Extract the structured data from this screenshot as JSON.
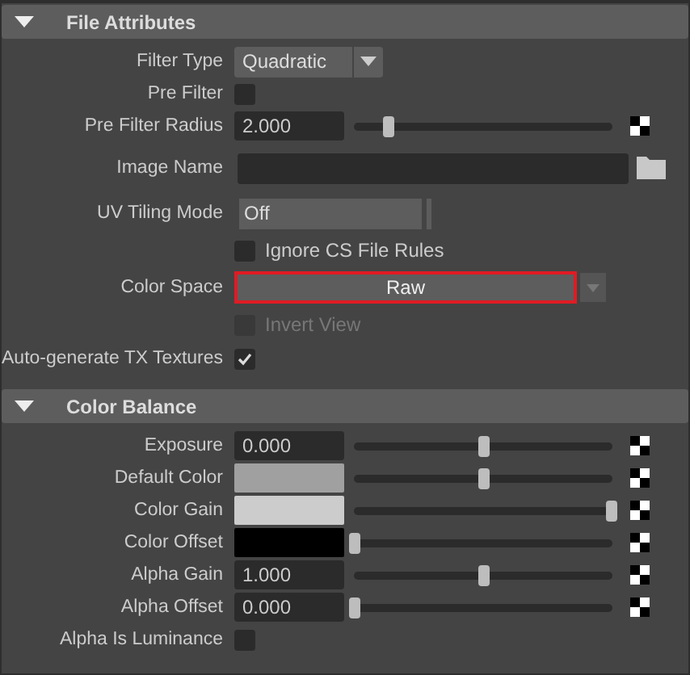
{
  "sections": [
    {
      "title": "File Attributes",
      "expanded": true,
      "rows": [
        {
          "kind": "dropdown",
          "label": "Filter Type",
          "value": "Quadratic"
        },
        {
          "kind": "checkbox",
          "label": "Pre Filter",
          "checked": false
        },
        {
          "kind": "slider",
          "label": "Pre Filter Radius",
          "value": "2.000",
          "level": 0.13
        },
        {
          "kind": "file",
          "label": "Image Name"
        },
        {
          "kind": "option",
          "label": "UV Tiling Mode",
          "value": "Off"
        },
        {
          "kind": "inline-checkbox",
          "text": "Ignore CS File Rules",
          "checked": false,
          "disabled": false
        },
        {
          "kind": "colorspace",
          "label": "Color Space",
          "value": "Raw",
          "highlighted": true
        },
        {
          "kind": "inline-checkbox",
          "text": "Invert View",
          "checked": false,
          "disabled": true
        },
        {
          "kind": "checkbox",
          "label": "Auto-generate TX Textures",
          "checked": true
        }
      ]
    },
    {
      "title": "Color Balance",
      "expanded": true,
      "rows": [
        {
          "kind": "slider",
          "label": "Exposure",
          "value": "0.000",
          "level": 0.5
        },
        {
          "kind": "color",
          "label": "Default Color",
          "color": "#a0a0a0",
          "level": 0.5
        },
        {
          "kind": "color",
          "label": "Color Gain",
          "color": "#cccccc",
          "level": 1
        },
        {
          "kind": "color",
          "label": "Color Offset",
          "color": "#000000",
          "level": 0
        },
        {
          "kind": "slider",
          "label": "Alpha Gain",
          "value": "1.000",
          "level": 0.5
        },
        {
          "kind": "slider",
          "label": "Alpha Offset",
          "value": "0.000",
          "level": 0
        },
        {
          "kind": "checkbox",
          "label": "Alpha Is Luminance",
          "checked": false
        }
      ]
    }
  ]
}
